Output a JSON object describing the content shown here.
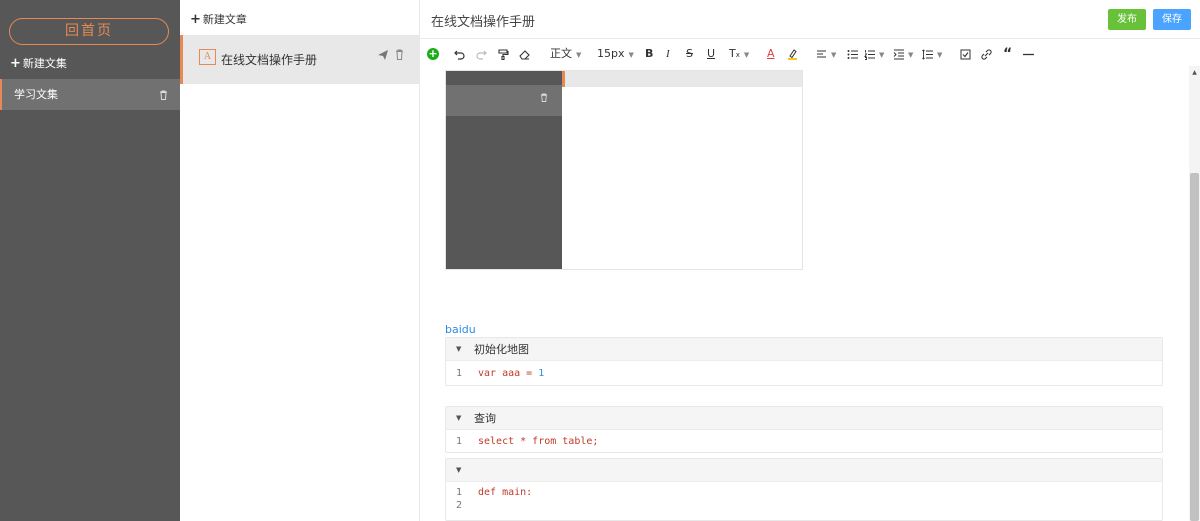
{
  "sidebar": {
    "home_label": "回首页",
    "new_collection": "新建文集",
    "collections": [
      {
        "label": "学习文集"
      }
    ]
  },
  "article_list": {
    "new_article": "新建文章",
    "items": [
      {
        "title": "在线文档操作手册",
        "icon_letter": "A"
      }
    ]
  },
  "editor": {
    "title": "在线文档操作手册",
    "publish_label": "发布",
    "save_label": "保存",
    "toolbar": {
      "heading": "正文",
      "font_size": "15px",
      "icons": [
        "add-icon",
        "undo-icon",
        "redo-icon",
        "format-painter-icon",
        "eraser-icon",
        "bold-icon",
        "italic-icon",
        "strikethrough-icon",
        "underline-icon",
        "text-format-icon",
        "font-color-icon",
        "highlight-icon",
        "align-icon",
        "bullet-list-icon",
        "ordered-list-icon",
        "indent-icon",
        "line-height-icon",
        "checkbox-icon",
        "link-icon",
        "quote-icon",
        "horizontal-rule-icon"
      ]
    },
    "link_text": "baidu",
    "code_blocks": [
      {
        "label": "初始化地图",
        "lines": [
          {
            "n": "1",
            "code": "var aaa = ",
            "num": "1"
          }
        ]
      },
      {
        "label": "查询",
        "lines": [
          {
            "n": "1",
            "code": "select * from table;",
            "num": ""
          }
        ]
      },
      {
        "label": "",
        "lines": [
          {
            "n": "1",
            "code": "def main:",
            "num": ""
          },
          {
            "n": "2",
            "code": "",
            "num": ""
          }
        ]
      }
    ]
  },
  "colors": {
    "accent": "#e58a55",
    "sidebar_bg": "#575757",
    "publish": "#67c23a",
    "save": "#4aa3ff",
    "link": "#2d8ce8"
  }
}
